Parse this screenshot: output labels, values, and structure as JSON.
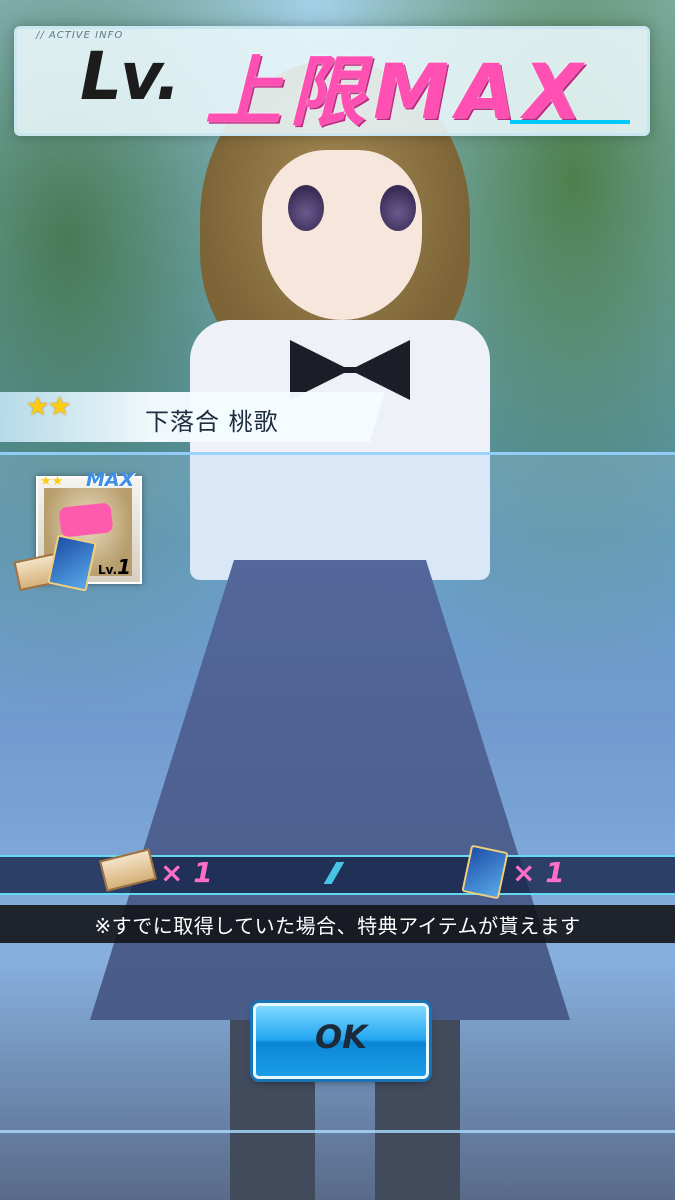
{
  "title": {
    "tag": "// ACTIVE INFO",
    "lv": "Lv.",
    "main": "上限MAX"
  },
  "character": {
    "rarity_stars": 2,
    "name": "下落合 桃歌"
  },
  "card": {
    "max_badge": "MAX",
    "level_prefix": "Lv.",
    "level_value": "1"
  },
  "rewards": [
    {
      "icon": "ticket-item-icon",
      "count": "× 1"
    },
    {
      "icon": "card-item-icon",
      "count": "× 1"
    }
  ],
  "notice": "※すでに取得していた場合、特典アイテムが貰えます",
  "ok_button": "OK",
  "colors": {
    "accent_pink": "#ff4fb2",
    "accent_cyan": "#00c9ff",
    "button_blue": "#23a6f0",
    "star_gold": "#ffcc14"
  }
}
